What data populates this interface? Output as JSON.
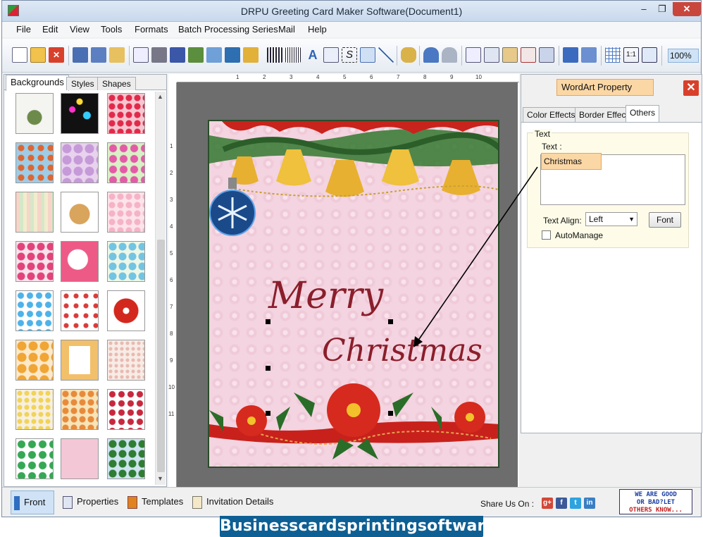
{
  "window": {
    "title": "DRPU Greeting Card Maker Software(Document1)",
    "min_glyph": "‒",
    "max_glyph": "❐",
    "close_glyph": "✕"
  },
  "menu": [
    "File",
    "Edit",
    "View",
    "Tools",
    "Formats",
    "Batch Processing Series",
    "Mail",
    "Help"
  ],
  "toolbar": {
    "zoom": "100%",
    "icons": [
      "new-icon",
      "open-icon",
      "close-doc-icon",
      "save-icon",
      "save-as-icon",
      "export-icon",
      "properties-icon",
      "print-icon",
      "print-preview-icon",
      "draw-icon",
      "image-icon",
      "pen-icon",
      "shape-icon",
      "barcode-icon",
      "barcode2-icon",
      "text-icon",
      "document-icon",
      "signature-icon",
      "email-icon",
      "line-icon",
      "database-icon",
      "undo-icon",
      "redo-icon",
      "cut-icon",
      "copy-icon",
      "paste-icon",
      "delete-icon",
      "paste-special-icon",
      "bring-front-icon",
      "send-back-icon",
      "grid-icon",
      "actual-size-icon",
      "fit-icon",
      "zoom-icon"
    ]
  },
  "left_panel": {
    "tabs": [
      "Backgrounds",
      "Styles",
      "Shapes"
    ],
    "active_tab": "Backgrounds"
  },
  "rulers": {
    "h": [
      "1",
      "2",
      "3",
      "4",
      "5",
      "6",
      "7",
      "8",
      "9",
      "10"
    ],
    "v": [
      "1",
      "2",
      "3",
      "4",
      "5",
      "6",
      "7",
      "8",
      "9",
      "10",
      "11"
    ]
  },
  "card": {
    "line1": "Merry",
    "line2": "Christmas"
  },
  "wordart": {
    "title": "WordArt Property",
    "close": "✕",
    "tabs": [
      "Color Effects",
      "Border Effect",
      "Others"
    ],
    "active_tab": "Others",
    "group_label": "Text",
    "text_label": "Text :",
    "text_value": "Christmas",
    "align_label": "Text Align:",
    "align_value": "Left",
    "font_button": "Font",
    "automanage_label": "AutoManage"
  },
  "status": {
    "items": [
      "Front",
      "Properties",
      "Templates",
      "Invitation Details"
    ],
    "active": "Front",
    "share_label": "Share Us On :",
    "social": [
      "g+",
      "f",
      "t",
      "in"
    ],
    "badge": [
      "WE ARE GOOD",
      "OR BAD?LET",
      "OTHERS KNOW..."
    ]
  },
  "watermark": "Businesscardsprintingsoftware.com",
  "colors": {
    "title_text": "#8b1e2b",
    "accent_orange": "#fbd7a5",
    "close_red": "#d9402b"
  }
}
